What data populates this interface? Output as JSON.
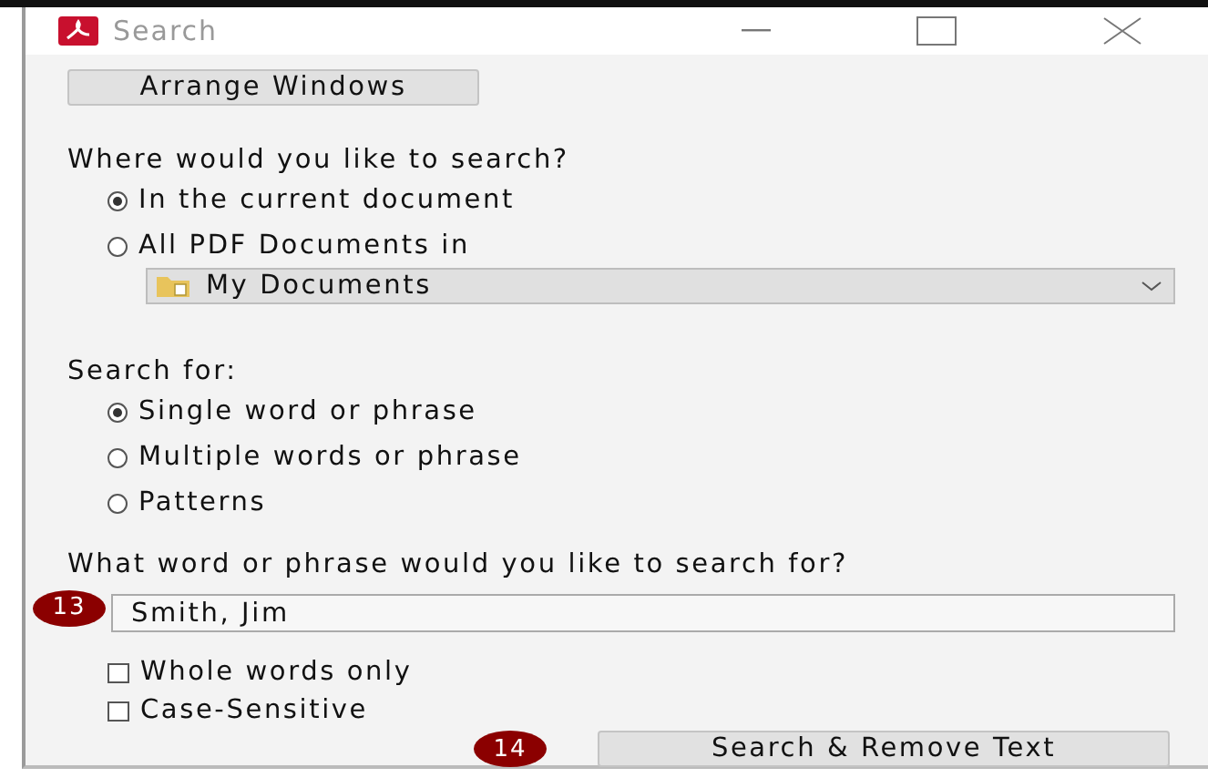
{
  "window": {
    "title": "Search"
  },
  "arrange_button": "Arrange Windows",
  "location": {
    "label": "Where would you like to search?",
    "options": [
      {
        "label": "In the current document",
        "selected": true
      },
      {
        "label": "All PDF Documents in",
        "selected": false
      }
    ],
    "folder": "My Documents"
  },
  "search_for": {
    "label": "Search for:",
    "options": [
      {
        "label": "Single word or phrase",
        "selected": true
      },
      {
        "label": "Multiple words or phrase",
        "selected": false
      },
      {
        "label": "Patterns",
        "selected": false
      }
    ]
  },
  "query": {
    "label": "What word or phrase would you like to search for?",
    "value": "Smith, Jim",
    "badge": "13"
  },
  "checkboxes": [
    {
      "label": "Whole words only",
      "checked": false
    },
    {
      "label": "Case-Sensitive",
      "checked": false
    }
  ],
  "action": {
    "label": "Search & Remove Text",
    "badge": "14"
  }
}
